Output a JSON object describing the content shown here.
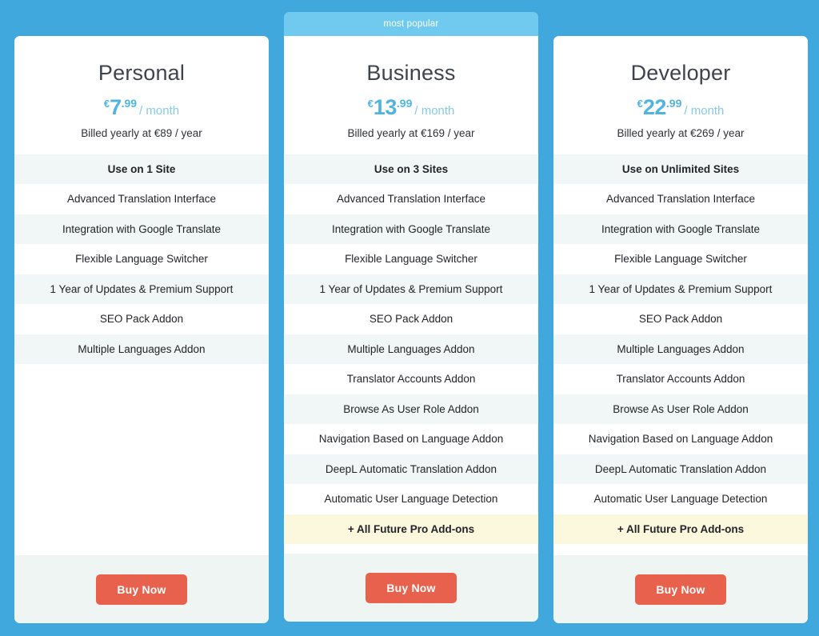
{
  "page": {
    "background_color": "#41a8dd",
    "accent_color": "#4fb4e1",
    "cta_color": "#e8614c",
    "highlight_row_color": "#fcf8dd"
  },
  "plans": [
    {
      "name": "Personal",
      "badge": "",
      "price": {
        "currency": "€",
        "amount": "7",
        "cents": ".99",
        "period": "/ month"
      },
      "billed": "Billed yearly at €89 / year",
      "features": [
        "Use on 1 Site",
        "Advanced Translation Interface",
        "Integration with Google Translate",
        "Flexible Language Switcher",
        "1 Year of Updates & Premium Support",
        "SEO Pack Addon",
        "Multiple Languages Addon"
      ],
      "cta": "Buy Now"
    },
    {
      "name": "Business",
      "badge": "most popular",
      "price": {
        "currency": "€",
        "amount": "13",
        "cents": ".99",
        "period": "/ month"
      },
      "billed": "Billed yearly at €169 / year",
      "features": [
        "Use on 3 Sites",
        "Advanced Translation Interface",
        "Integration with Google Translate",
        "Flexible Language Switcher",
        "1 Year of Updates & Premium Support",
        "SEO Pack Addon",
        "Multiple Languages Addon",
        "Translator Accounts Addon",
        "Browse As User Role Addon",
        "Navigation Based on Language Addon",
        "DeepL Automatic Translation Addon",
        "Automatic User Language Detection",
        "+ All Future Pro Add-ons"
      ],
      "cta": "Buy Now"
    },
    {
      "name": "Developer",
      "badge": "",
      "price": {
        "currency": "€",
        "amount": "22",
        "cents": ".99",
        "period": "/ month"
      },
      "billed": "Billed yearly at €269 / year",
      "features": [
        "Use on Unlimited Sites",
        "Advanced Translation Interface",
        "Integration with Google Translate",
        "Flexible Language Switcher",
        "1 Year of Updates & Premium Support",
        "SEO Pack Addon",
        "Multiple Languages Addon",
        "Translator Accounts Addon",
        "Browse As User Role Addon",
        "Navigation Based on Language Addon",
        "DeepL Automatic Translation Addon",
        "Automatic User Language Detection",
        "+ All Future Pro Add-ons"
      ],
      "cta": "Buy Now"
    }
  ]
}
